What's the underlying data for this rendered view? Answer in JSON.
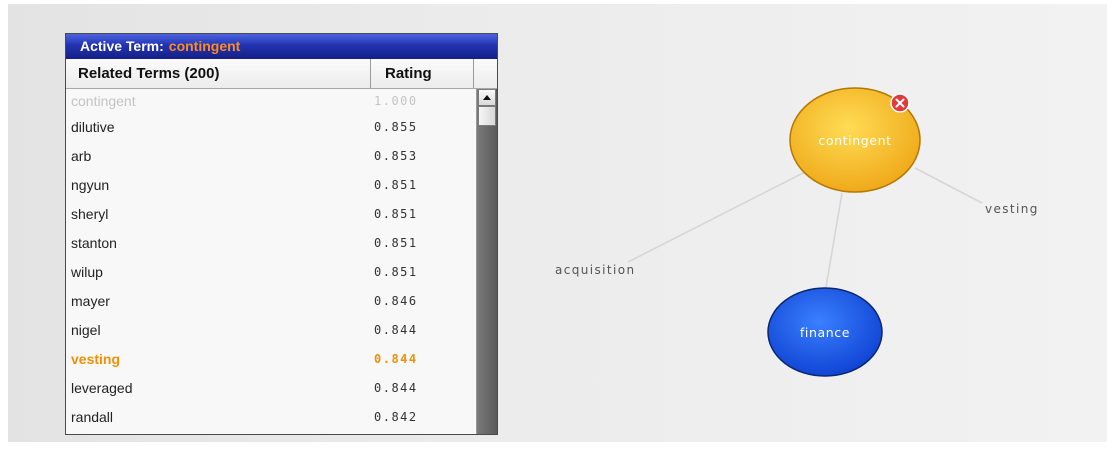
{
  "panel": {
    "title_label": "Active Term:",
    "title_value": "contingent",
    "columns": {
      "term": "Related Terms (200)",
      "rating": "Rating"
    },
    "rows": [
      {
        "term": "contingent",
        "rating": "1.000",
        "dimmed": true
      },
      {
        "term": "dilutive",
        "rating": "0.855"
      },
      {
        "term": "arb",
        "rating": "0.853"
      },
      {
        "term": "ngyun",
        "rating": "0.851"
      },
      {
        "term": "sheryl",
        "rating": "0.851"
      },
      {
        "term": "stanton",
        "rating": "0.851"
      },
      {
        "term": "wilup",
        "rating": "0.851"
      },
      {
        "term": "mayer",
        "rating": "0.846"
      },
      {
        "term": "nigel",
        "rating": "0.844"
      },
      {
        "term": "vesting",
        "rating": "0.844",
        "highlighted": true
      },
      {
        "term": "leveraged",
        "rating": "0.844"
      },
      {
        "term": "randall",
        "rating": "0.842"
      }
    ]
  },
  "scrollbar": {
    "up_icon": "arrow-up-icon",
    "position": 0
  },
  "graph": {
    "active_node": {
      "label": "contingent",
      "close_icon": "close-icon"
    },
    "child_nodes": [
      {
        "label": "finance"
      }
    ],
    "term_labels": [
      "acquisition",
      "vesting"
    ]
  },
  "colors": {
    "title_bar": "#2233b0",
    "active_term": "#ff8b1f",
    "highlight": "#f0900a",
    "dimmed": "#c4c4c4",
    "node_active": "#eea515",
    "node_child": "#0c3fcf",
    "close": "#e23a3a",
    "edge": "#d6d6d6"
  }
}
